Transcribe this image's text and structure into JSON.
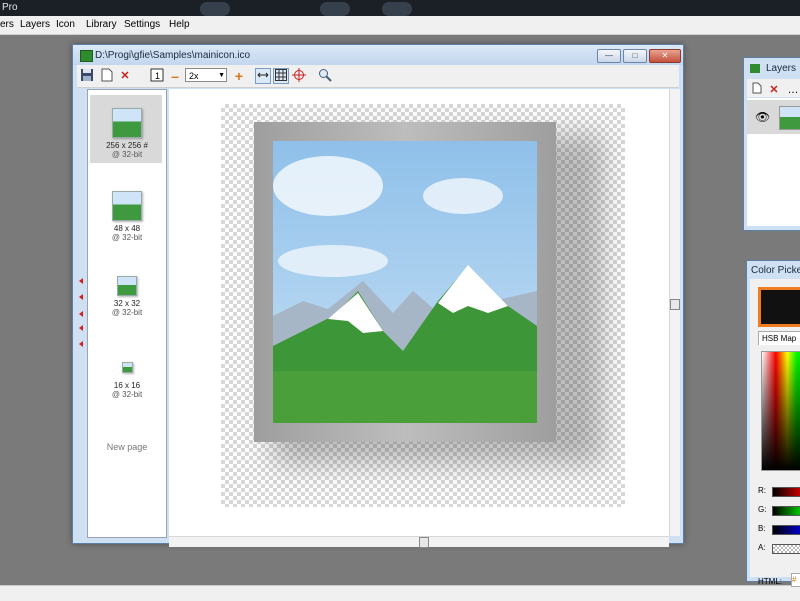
{
  "app": {
    "title_fragment": "Pro"
  },
  "menubar": {
    "items": [
      "ers",
      "Layers",
      "Icon",
      "Library",
      "Settings",
      "Help"
    ]
  },
  "document": {
    "title": "D:\\Progi\\gfie\\Samples\\mainicon.ico",
    "zoom": "2x",
    "toolbar": {
      "icons": [
        "save-icon",
        "new-page-icon",
        "delete-icon",
        "actual-size-icon",
        "zoom-out-icon",
        "zoom-in-icon",
        "fit-icon",
        "grid-icon",
        "crosshair-icon",
        "search-icon"
      ]
    },
    "pages": [
      {
        "size": "256 x 256 #",
        "depth": "@ 32-bit",
        "selected": true
      },
      {
        "size": "48 x 48",
        "depth": "@ 32-bit",
        "selected": false
      },
      {
        "size": "32 x 32",
        "depth": "@ 32-bit",
        "selected": false
      },
      {
        "size": "16 x 16",
        "depth": "@ 32-bit",
        "selected": false
      }
    ],
    "new_page_label": "New page"
  },
  "layers_panel": {
    "title": "Layers"
  },
  "color_picker": {
    "title": "Color Picker",
    "tab": "HSB Map",
    "current_color": "#111111",
    "channels": [
      "R:",
      "G:",
      "B:",
      "A:"
    ],
    "html_label": "HTML:",
    "html_value": "#"
  },
  "colors": {
    "accent": "#f07c1f",
    "window_frame": "#cfe0f3",
    "sky": "#9cc7ea",
    "grass": "#3f9a3f"
  }
}
